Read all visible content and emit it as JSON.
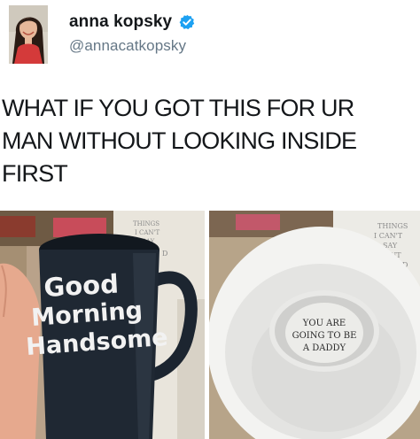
{
  "tweet": {
    "author": {
      "display_name": "anna kopsky",
      "handle": "@annacatkopsky",
      "verified": true,
      "avatar_icon": "profile-photo"
    },
    "text": "WHAT IF YOU GOT THIS FOR UR\nMAN WITHOUT LOOKING INSIDE\nFIRST",
    "photos": [
      {
        "name": "mug-outside",
        "mug_text": [
          "Good",
          "Morning",
          "Handsome"
        ],
        "sign_text": [
          "THINGS",
          "I CAN'T",
          "SAY",
          "D"
        ]
      },
      {
        "name": "mug-inside",
        "bottom_text": [
          "YOU ARE",
          "GOING TO BE",
          "A DADDY"
        ],
        "sign_text": [
          "THINGS",
          "I CAN'T",
          "SAY",
          "OUT",
          "D"
        ]
      }
    ]
  },
  "colors": {
    "verified_badge": "#1da1f2",
    "handle": "#657786",
    "text": "#14171a",
    "mug_navy": "#1c2530"
  }
}
